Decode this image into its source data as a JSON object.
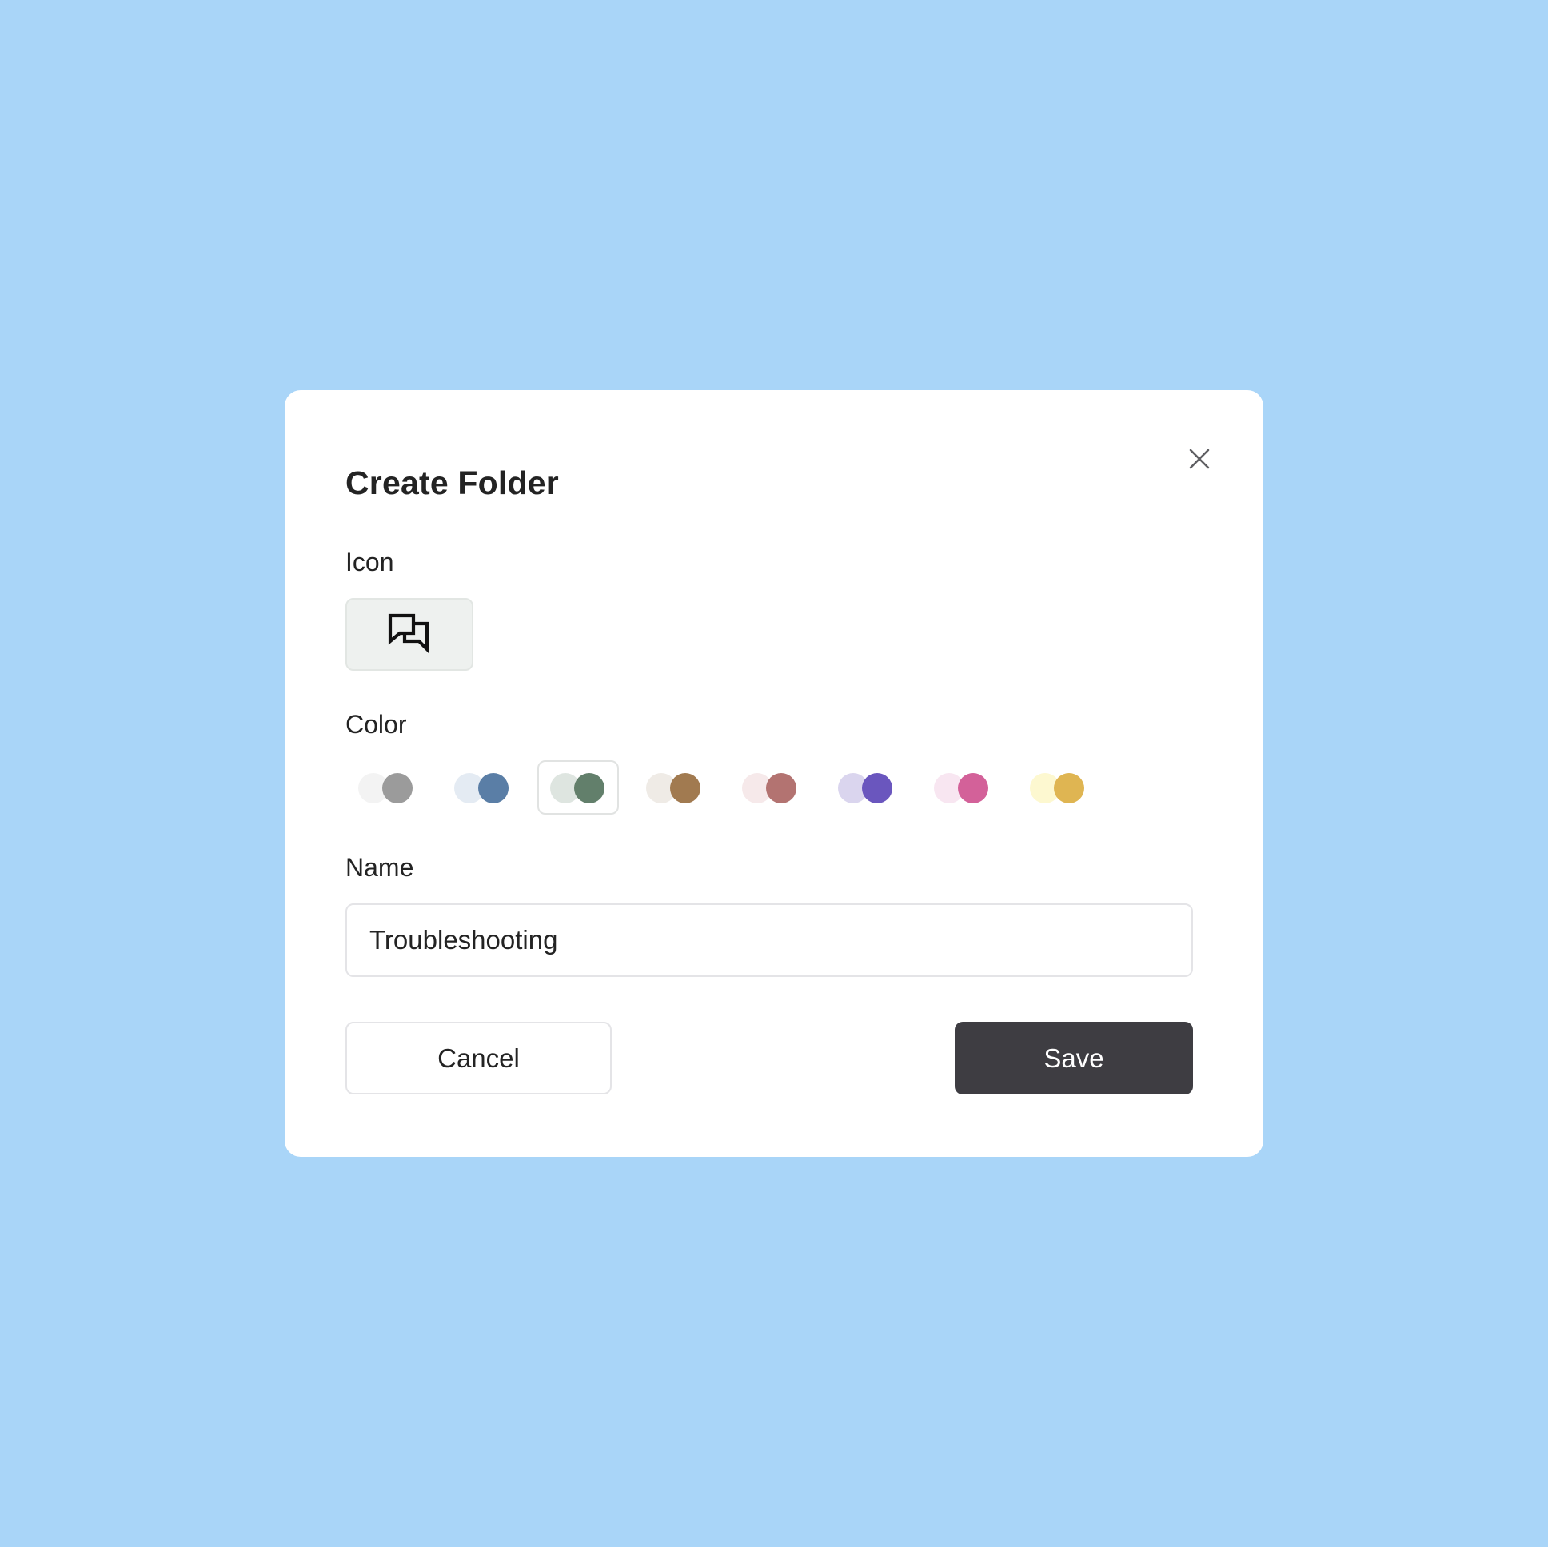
{
  "dialog": {
    "title": "Create Folder",
    "close_icon": "close-icon"
  },
  "icon_section": {
    "label": "Icon",
    "selected_icon": "chat-bubbles-icon"
  },
  "color_section": {
    "label": "Color",
    "selected_index": 2,
    "options": [
      {
        "name": "gray",
        "light": "#f3f3f3",
        "dark": "#9b9b9b"
      },
      {
        "name": "blue",
        "light": "#e4ebf3",
        "dark": "#5a7ea6"
      },
      {
        "name": "green",
        "light": "#dee5e0",
        "dark": "#627f6b"
      },
      {
        "name": "brown",
        "light": "#efebe6",
        "dark": "#a17a50"
      },
      {
        "name": "red",
        "light": "#f6e9ea",
        "dark": "#b37371"
      },
      {
        "name": "purple",
        "light": "#dad5ee",
        "dark": "#6a56be"
      },
      {
        "name": "pink",
        "light": "#f8e6f1",
        "dark": "#d36199"
      },
      {
        "name": "yellow",
        "light": "#fdf8d0",
        "dark": "#dfb552"
      }
    ]
  },
  "name_section": {
    "label": "Name",
    "value": "Troubleshooting"
  },
  "actions": {
    "cancel_label": "Cancel",
    "save_label": "Save"
  }
}
